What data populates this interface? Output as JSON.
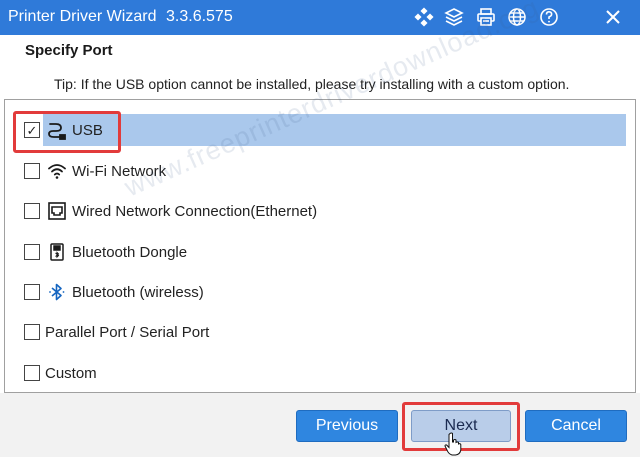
{
  "titlebar": {
    "title": "Printer Driver Wizard",
    "version": "3.3.6.575",
    "icons": [
      "apps-icon",
      "layers-icon",
      "printer-icon",
      "globe-icon",
      "help-icon",
      "close-icon"
    ]
  },
  "section_title": "Specify Port",
  "tip": "Tip: If the USB option cannot be installed, please try installing with a custom option.",
  "ports": [
    {
      "label": "USB",
      "checked": true,
      "icon": "usb-cable-icon"
    },
    {
      "label": "Wi-Fi Network",
      "checked": false,
      "icon": "wifi-icon"
    },
    {
      "label": "Wired Network Connection(Ethernet)",
      "checked": false,
      "icon": "ethernet-icon"
    },
    {
      "label": "Bluetooth Dongle",
      "checked": false,
      "icon": "bluetooth-dongle-icon"
    },
    {
      "label": "Bluetooth (wireless)",
      "checked": false,
      "icon": "bluetooth-icon"
    },
    {
      "label": "Parallel Port / Serial Port",
      "checked": false,
      "icon": ""
    },
    {
      "label": "Custom",
      "checked": false,
      "icon": ""
    }
  ],
  "watermark": "www.freeprinterdriverdownload.org",
  "buttons": {
    "previous": "Previous",
    "next": "Next",
    "cancel": "Cancel"
  },
  "colors": {
    "titlebar": "#2f7ad9",
    "selected_row": "#aac8ec",
    "button": "#2f86e0",
    "highlight": "#e23b3b"
  }
}
